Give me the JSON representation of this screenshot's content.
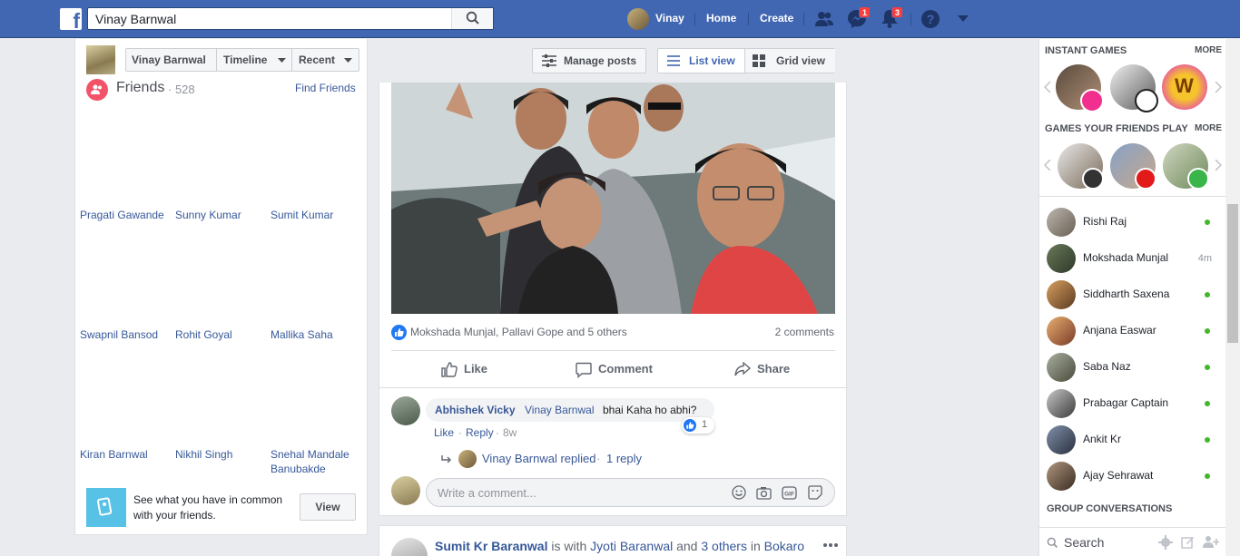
{
  "topbar": {
    "logo": "f",
    "search_value": "Vinay Barnwal",
    "user_name": "Vinay",
    "home": "Home",
    "create": "Create",
    "messages_badge": "1",
    "notifications_badge": "3"
  },
  "profile_nav": {
    "name": "Vinay Barnwal",
    "timeline": "Timeline",
    "recent": "Recent",
    "manage_posts": "Manage posts",
    "list_view": "List view",
    "grid_view": "Grid view"
  },
  "friends": {
    "title": "Friends",
    "count": "· 528",
    "find_friends": "Find Friends",
    "names": [
      "Pragati Gawande",
      "Sunny Kumar",
      "Sumit Kumar",
      "Swapnil Bansod",
      "Rohit Goyal",
      "Mallika Saha",
      "Kiran Barnwal",
      "Nikhil Singh",
      "Snehal Mandale Banubakde"
    ],
    "common_text": "See what you have in common with your friends.",
    "view_button": "View"
  },
  "post": {
    "reactions_text": "Mokshada Munjal, Pallavi Gope and 5 others",
    "comments_count": "2 comments",
    "like": "Like",
    "comment": "Comment",
    "share": "Share",
    "comment1_author": "Abhishek Vicky",
    "comment1_tag": "Vinay Barnwal",
    "comment1_text": "bhai Kaha ho abhi?",
    "comment1_like": "Like",
    "comment1_reply": "Reply",
    "comment1_time": "8w",
    "comment1_reaction_count": "1",
    "reply_author": "Vinay Barnwal replied",
    "reply_count": "1 reply",
    "write_placeholder": "Write a comment..."
  },
  "post2": {
    "author": "Sumit Kr Baranwal",
    "is_with": "is with",
    "with_name": "Jyoti Baranwal",
    "and": "and",
    "others": "3 others",
    "in": "in",
    "place": "Bokaro"
  },
  "right": {
    "instant_games": "INSTANT GAMES",
    "more1": "MORE",
    "friends_games": "GAMES YOUR FRIENDS PLAY",
    "more2": "MORE",
    "contacts": [
      {
        "name": "Rishi Raj",
        "status": "online"
      },
      {
        "name": "Mokshada Munjal",
        "time": "4m"
      },
      {
        "name": "Siddharth Saxena",
        "status": "online"
      },
      {
        "name": "Anjana Easwar",
        "status": "online"
      },
      {
        "name": "Saba Naz",
        "status": "online"
      },
      {
        "name": "Prabagar Captain",
        "status": "online"
      },
      {
        "name": "Ankit Kr",
        "status": "online"
      },
      {
        "name": "Ajay Sehrawat",
        "status": "online"
      }
    ],
    "group_conversations": "GROUP CONVERSATIONS",
    "search_placeholder": "Search"
  },
  "colors": {
    "brand": "#4267b2",
    "link": "#365899",
    "online": "#42b72a",
    "badge": "#fa3e3e"
  }
}
